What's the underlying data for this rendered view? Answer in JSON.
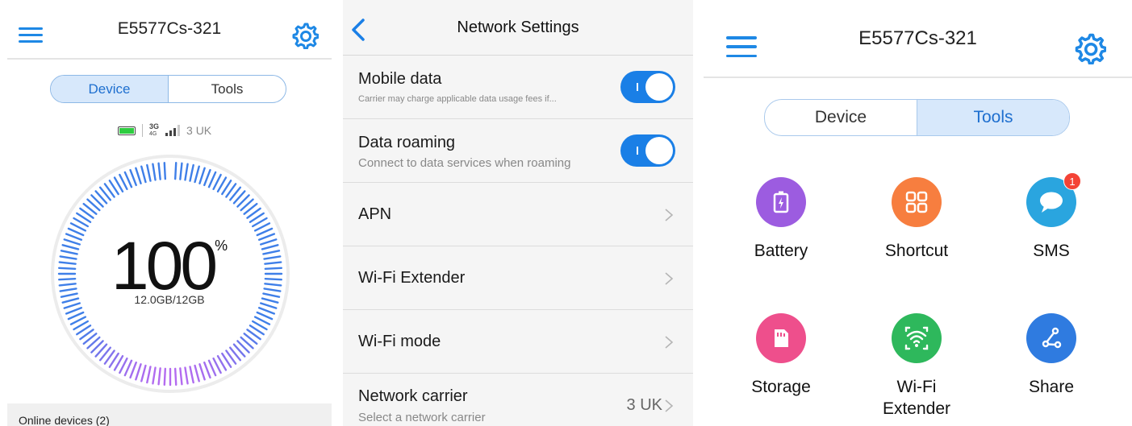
{
  "panel1": {
    "title": "E5577Cs-321",
    "tabs": [
      {
        "label": "Device",
        "active": true
      },
      {
        "label": "Tools",
        "active": false
      }
    ],
    "status": {
      "network_type_top": "3G",
      "network_type_bottom": "4G",
      "operator": "3 UK"
    },
    "data_remaining_percent": "100",
    "percent_sign": "%",
    "usage": "12.0GB/12GB",
    "online_devices": "Online devices (2)",
    "colors": {
      "accent": "#1e88e5",
      "dial_blue": "#3f7fe8",
      "dial_violet": "#b46bf0"
    }
  },
  "panel2": {
    "title": "Network Settings",
    "rows": [
      {
        "label": "Mobile data",
        "subtitle": "Carrier may charge applicable data usage fees if...",
        "toggle": true
      },
      {
        "label": "Data roaming",
        "subtitle": "Connect to data services when roaming",
        "toggle": true
      },
      {
        "label": "APN",
        "chevron": true
      },
      {
        "label": "Wi-Fi Extender",
        "chevron": true
      },
      {
        "label": "Wi-Fi mode",
        "chevron": true
      },
      {
        "label": "Network carrier",
        "subtitle": "Select a network carrier",
        "value": "3 UK",
        "chevron": true
      }
    ]
  },
  "panel3": {
    "title": "E5577Cs-321",
    "tabs": [
      {
        "label": "Device",
        "active": false
      },
      {
        "label": "Tools",
        "active": true
      }
    ],
    "tools": [
      {
        "label": "Battery",
        "icon": "battery-icon",
        "color": "#9c5ce0"
      },
      {
        "label": "Shortcut",
        "icon": "shortcut-icon",
        "color": "#f77e3f"
      },
      {
        "label": "SMS",
        "icon": "sms-icon",
        "color": "#2aa5df",
        "badge": "1"
      },
      {
        "label": "Storage",
        "icon": "storage-icon",
        "color": "#ee4f8c"
      },
      {
        "label": "Wi-Fi\nExtender",
        "icon": "wifi-extender-icon",
        "color": "#2eb85c"
      },
      {
        "label": "Share",
        "icon": "share-icon",
        "color": "#2f7be0"
      }
    ]
  }
}
